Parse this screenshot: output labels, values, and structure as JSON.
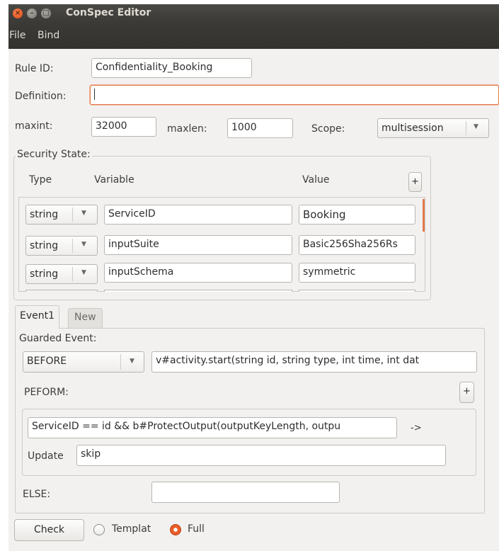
{
  "window": {
    "title": "ConSpec Editor",
    "close_glyph": "×",
    "min_glyph": "–",
    "max_glyph": "□"
  },
  "menu": {
    "items": [
      "File",
      "Bind"
    ]
  },
  "rule": {
    "rule_id_label": "Rule ID:",
    "rule_id_value": "Confidentiality_Booking",
    "definition_label": "Definition:",
    "definition_value": "",
    "maxint_label": "maxint:",
    "maxint_value": "32000",
    "maxlen_label": "maxlen:",
    "maxlen_value": "1000",
    "scope_label": "Scope:",
    "scope_value": "multisession"
  },
  "security_state": {
    "title": "Security State:",
    "headers": {
      "type": "Type",
      "variable": "Variable",
      "value": "Value"
    },
    "add_label": "+",
    "rows": [
      {
        "type": "string",
        "variable": "ServiceID",
        "value": "Booking"
      },
      {
        "type": "string",
        "variable": "inputSuite",
        "value": "Basic256Sha256Rs"
      },
      {
        "type": "string",
        "variable": "inputSchema",
        "value": "symmetric"
      }
    ]
  },
  "tabs": [
    {
      "label": "Event1",
      "active": true
    },
    {
      "label": "New",
      "active": false
    }
  ],
  "event": {
    "guarded_title": "Guarded Event:",
    "modifier": "BEFORE",
    "signature": "v#activity.start(string id, string type, int time, int dat",
    "perform_label": "PEFORM:",
    "add_label": "+",
    "guard": "ServiceID == id && b#ProtectOutput(outputKeyLength, outpu",
    "arrow": "->",
    "update_label": "Update",
    "update_value": "skip",
    "else_label": "ELSE:",
    "else_value": ""
  },
  "footer": {
    "check_label": "Check",
    "radio_template": "Templat",
    "radio_full": "Full",
    "selected": "Full"
  },
  "icons": {
    "dropdown": "chevron-down-icon"
  },
  "colors": {
    "accent": "#e85c26",
    "titlebar": "#3b3a37",
    "background": "#f2f1f0"
  }
}
